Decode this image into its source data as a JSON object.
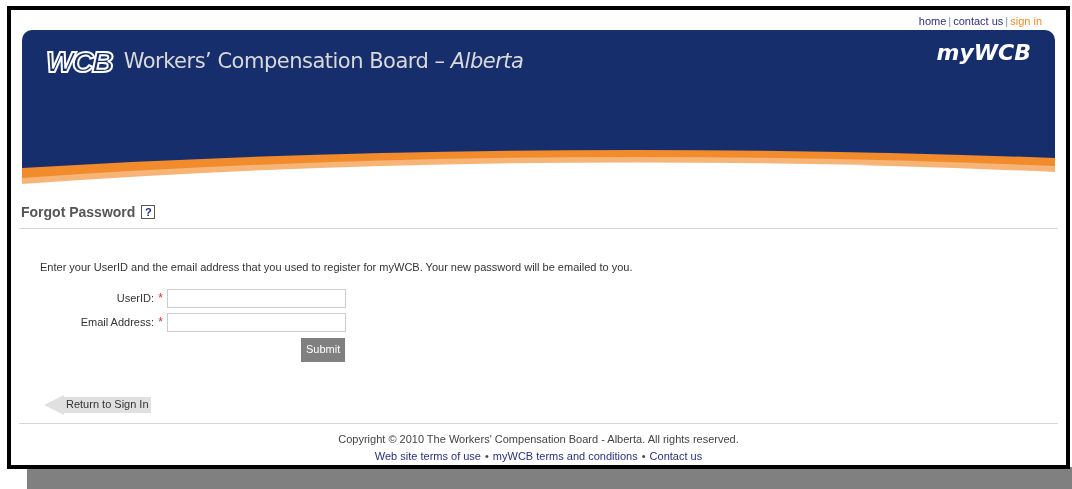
{
  "top_links": [
    {
      "label": "home",
      "highlighted": false
    },
    {
      "label": "contact us",
      "highlighted": false
    },
    {
      "label": "sign in",
      "highlighted": true
    }
  ],
  "top_separator": "|",
  "header": {
    "logo": "WCB",
    "organization": "Workers’ Compensation Board –",
    "region": "Alberta",
    "product": "myWCB"
  },
  "page_title": "Forgot Password",
  "help_icon": "?",
  "instructions": "Enter your UserID and the email address that you used to register for myWCB. Your new password will be emailed to you.",
  "fields": [
    {
      "label": "UserID:",
      "required_mark": "*"
    },
    {
      "label": "Email Address:",
      "required_mark": "*"
    }
  ],
  "submit": "Submit",
  "return_link": "Return to Sign In",
  "footer": {
    "copyright": "Copyright © 2010 The Workers' Compensation Board - Alberta. All rights reserved.",
    "separator": "•",
    "links": [
      "Web site terms of use",
      "myWCB terms and conditions",
      "Contact us"
    ]
  }
}
